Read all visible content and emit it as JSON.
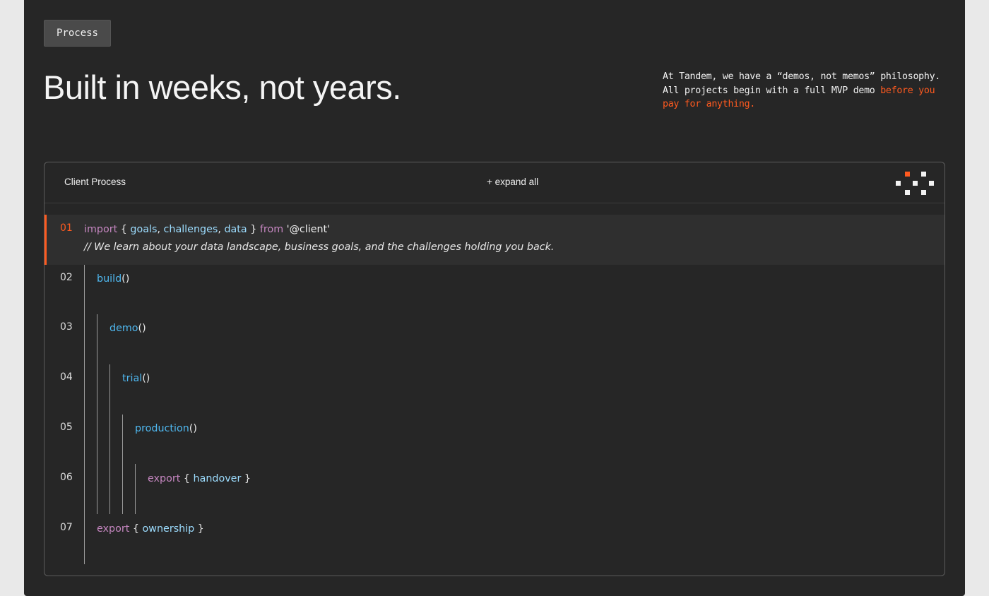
{
  "process_button": {
    "label": "Process"
  },
  "headline": "Built in weeks, not years.",
  "blurb": {
    "text": "At Tandem, we have a “demos, not memos” philosophy. All projects begin with a full MVP demo ",
    "accent": "before you pay for anything."
  },
  "colors": {
    "accent": "#ff5a1f",
    "keyword": "#c586c0",
    "identifier": "#9cdcfe",
    "function": "#4fb8f0",
    "background": "#262626"
  },
  "client_process": {
    "title": "Client Process",
    "expand_label": "+ expand all",
    "logo_icon": "pixel-dots-icon",
    "lines": [
      {
        "num": "01",
        "keyword": "import",
        "open": "{",
        "ids": [
          "goals",
          "challenges",
          "data"
        ],
        "close": "}",
        "from": "from",
        "module": "'@client'",
        "comment": "// We learn about your data landscape, business goals, and the challenges holding you back."
      },
      {
        "num": "02",
        "fn": "build",
        "parens": "()"
      },
      {
        "num": "03",
        "fn": "demo",
        "parens": "()"
      },
      {
        "num": "04",
        "fn": "trial",
        "parens": "()"
      },
      {
        "num": "05",
        "fn": "production",
        "parens": "()"
      },
      {
        "num": "06",
        "keyword": "export",
        "open": "{",
        "id": "handover",
        "close": "}"
      },
      {
        "num": "07",
        "keyword": "export",
        "open": "{",
        "id": "ownership",
        "close": "}"
      }
    ]
  }
}
